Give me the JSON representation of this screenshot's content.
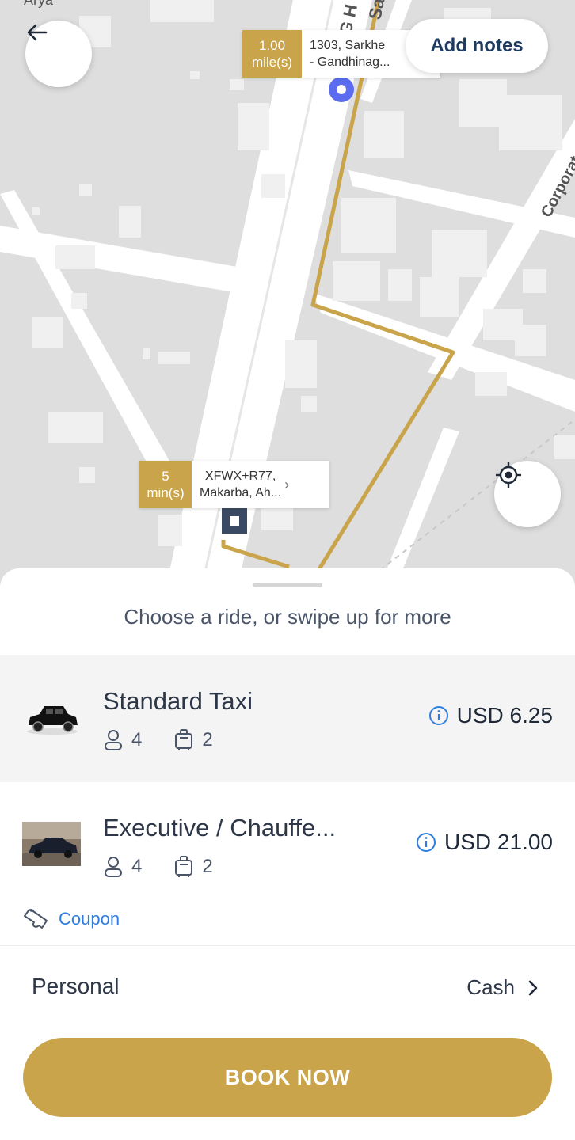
{
  "map": {
    "pickup_label": {
      "badge_line1": "1.00",
      "badge_line2": "mile(s)",
      "address_line1": "1303, Sarkhe",
      "address_line2": "- Gandhinag..."
    },
    "dropoff_label": {
      "badge_line1": "5",
      "badge_line2": "min(s)",
      "address_line1": "XFWX+R77,",
      "address_line2": "Makarba, Ah..."
    },
    "street_labels": {
      "sg": "SG H",
      "sa": "Sa",
      "corporate": "Corporat",
      "top_left": "Arya"
    },
    "notes_button_label": "Add notes",
    "route_color": "#c9a44a",
    "pickup_pin_color": "#5b6cf0"
  },
  "sheet": {
    "hint": "Choose a ride, or swipe up for more",
    "rides": [
      {
        "name": "Standard Taxi",
        "passengers": "4",
        "luggage": "2",
        "price": "USD 6.25",
        "image_icon": "black-taxi-image",
        "selected": true
      },
      {
        "name": "Executive / Chauffe...",
        "passengers": "4",
        "luggage": "2",
        "price": "USD 21.00",
        "image_icon": "executive-car-image",
        "selected": false
      }
    ],
    "coupon_label": "Coupon",
    "payment": {
      "profile": "Personal",
      "method": "Cash"
    },
    "book_button_label": "BOOK NOW"
  },
  "colors": {
    "accent": "#c9a44a",
    "link": "#2f7de1",
    "info": "#2f7de1"
  }
}
